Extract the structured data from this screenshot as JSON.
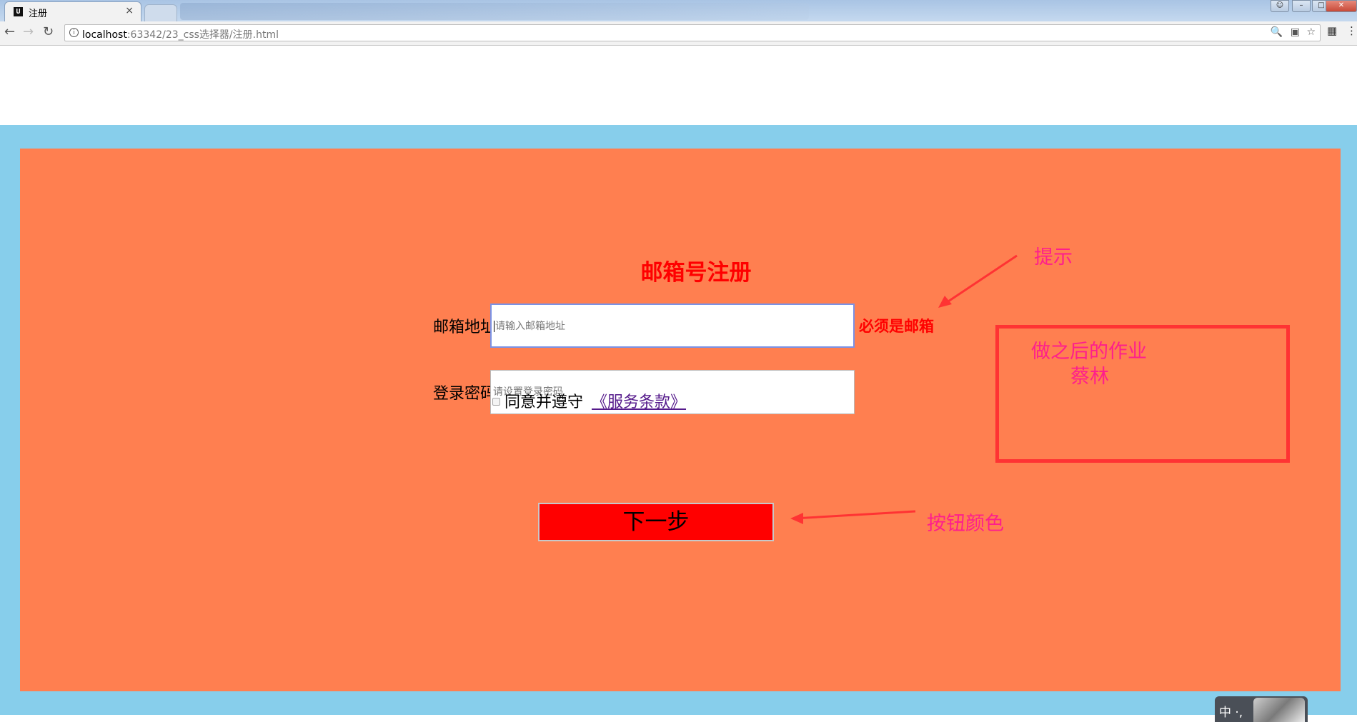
{
  "browser": {
    "tab_title": "注册",
    "tab_favicon": "U",
    "tab_close": "×",
    "url_host": "localhost",
    "url_path": ":63342/23_css选择器/注册.html"
  },
  "form": {
    "title": "邮箱号注册",
    "email_label": "邮箱地址",
    "email_placeholder": "请输入邮箱地址",
    "email_hint": "必须是邮箱",
    "password_label": "登录密码",
    "password_placeholder": "请设置登录密码",
    "agree_text": "同意并遵守",
    "terms_link": "《服务条款》",
    "next_button": "下一步"
  },
  "annotations": {
    "hint_note": "提示",
    "homework_line1": "做之后的作业",
    "homework_line2": "蔡林",
    "button_note": "按钮颜色"
  },
  "ime": {
    "mode": "中 ·,"
  },
  "colors": {
    "page_background": "#87ceeb",
    "form_background": "#ff7f50",
    "title_color": "#ff0000",
    "button_background": "#ff0000",
    "annotation_color": "#ff1e8c",
    "annotation_arrow": "#ff3333"
  }
}
